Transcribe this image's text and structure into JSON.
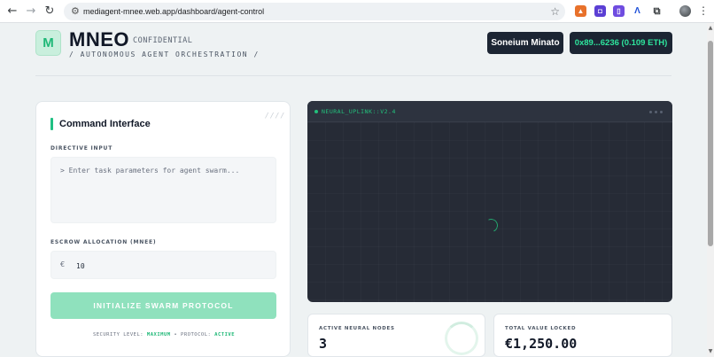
{
  "browser": {
    "url": "mediagent-mnee.web.app/dashboard/agent-control"
  },
  "header": {
    "logo_letter": "M",
    "brand": "MNEO",
    "confidential": "CONFIDENTIAL",
    "subtitle": "/ AUTONOMOUS AGENT ORCHESTRATION /",
    "network_label": "Soneium Minato",
    "wallet_label": "0x89...6236 (0.109 ETH)"
  },
  "command": {
    "title": "Command Interface",
    "deco": "////",
    "directive_label": "DIRECTIVE INPUT",
    "directive_placeholder": "> Enter task parameters for agent swarm...",
    "escrow_label": "ESCROW ALLOCATION (MNEE)",
    "escrow_symbol": "€",
    "escrow_value": "10",
    "init_button": "INITIALIZE SWARM PROTOCOL",
    "security_prefix": "SECURITY LEVEL:",
    "security_level": "MAXIMUM",
    "security_sep": "• PROTOCOL:",
    "protocol_status": "ACTIVE"
  },
  "terminal": {
    "title": "NEURAL_UPLINK::V2.4"
  },
  "stats": {
    "nodes_label": "ACTIVE NEURAL NODES",
    "nodes_value": "3",
    "tvl_label": "TOTAL VALUE LOCKED",
    "tvl_value": "€1,250.00"
  },
  "colors": {
    "accent": "#20c083",
    "dark": "#1c2533",
    "terminal_bg": "#262b36"
  }
}
